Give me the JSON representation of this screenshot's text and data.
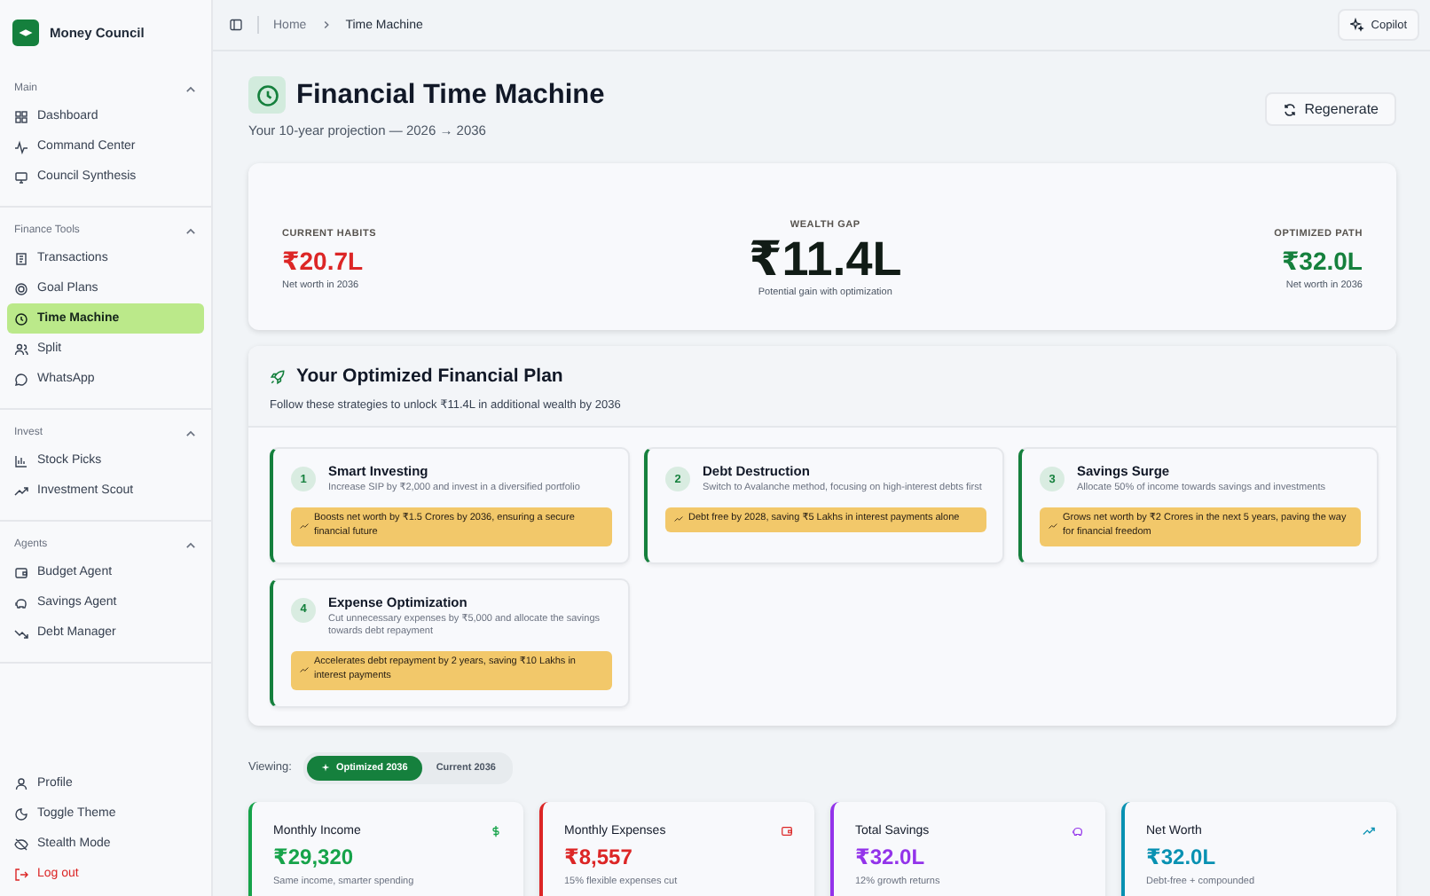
{
  "app": {
    "name": "Money Council"
  },
  "sidebar": {
    "sections": [
      {
        "title": "Main",
        "expanded": true,
        "items": [
          {
            "label": "Dashboard",
            "selected": false
          },
          {
            "label": "Command Center",
            "selected": false
          },
          {
            "label": "Council Synthesis",
            "selected": false
          }
        ]
      },
      {
        "title": "Finance Tools",
        "expanded": true,
        "items": [
          {
            "label": "Transactions",
            "selected": false
          },
          {
            "label": "Goal Plans",
            "selected": false
          },
          {
            "label": "Time Machine",
            "selected": true
          },
          {
            "label": "Split",
            "selected": false
          },
          {
            "label": "WhatsApp",
            "selected": false
          }
        ]
      },
      {
        "title": "Invest",
        "expanded": true,
        "items": [
          {
            "label": "Stock Picks",
            "selected": false
          },
          {
            "label": "Investment Scout",
            "selected": false
          }
        ]
      },
      {
        "title": "Agents",
        "expanded": true,
        "items": [
          {
            "label": "Budget Agent",
            "selected": false
          },
          {
            "label": "Savings Agent",
            "selected": false
          },
          {
            "label": "Debt Manager",
            "selected": false
          }
        ]
      }
    ],
    "footer": [
      {
        "label": "Profile",
        "kind": "normal"
      },
      {
        "label": "Toggle Theme",
        "kind": "normal"
      },
      {
        "label": "Stealth Mode",
        "kind": "normal"
      },
      {
        "label": "Log out",
        "kind": "danger"
      }
    ]
  },
  "breadcrumb": [
    "Home",
    "Time Machine"
  ],
  "copilot_button": "Copilot",
  "header": {
    "title": "Financial Time Machine",
    "subtitle": "Your 10-year projection — 2026 → 2036",
    "regenerate_button": "Regenerate"
  },
  "summary": {
    "current": {
      "label": "CURRENT HABITS",
      "value": "₹20.7L",
      "note": "Net worth in 2036"
    },
    "gap": {
      "label": "WEALTH GAP",
      "value": "₹11.4L",
      "note": "Potential gain with optimization"
    },
    "optimized": {
      "label": "OPTIMIZED PATH",
      "value": "₹32.0L",
      "note": "Net worth in 2036"
    }
  },
  "plan": {
    "title": "Your Optimized Financial Plan",
    "subtitle": "Follow these strategies to unlock ₹11.4L in additional wealth by 2036",
    "steps": [
      {
        "number": "1",
        "title": "Smart Investing",
        "description": "Increase SIP by ₹2,000 and invest in a diversified portfolio",
        "impact": "Boosts net worth by ₹1.5 Crores by 2036, ensuring a secure financial future"
      },
      {
        "number": "2",
        "title": "Debt Destruction",
        "description": "Switch to Avalanche method, focusing on high-interest debts first",
        "impact": "Debt free by 2028, saving ₹5 Lakhs in interest payments alone"
      },
      {
        "number": "3",
        "title": "Savings Surge",
        "description": "Allocate 50% of income towards savings and investments",
        "impact": "Grows net worth by ₹2 Crores in the next 5 years, paving the way for financial freedom"
      },
      {
        "number": "4",
        "title": "Expense Optimization",
        "description": "Cut unnecessary expenses by ₹5,000 and allocate the savings towards debt repayment",
        "impact": "Accelerates debt repayment by 2 years, saving ₹10 Lakhs in interest payments"
      }
    ]
  },
  "viewing": {
    "label": "Viewing:",
    "options": [
      {
        "label": "Optimized 2036",
        "selected": true
      },
      {
        "label": "Current 2036",
        "selected": false
      }
    ]
  },
  "stats": [
    {
      "title": "Monthly Income",
      "value": "₹29,320",
      "note": "Same income, smarter spending",
      "color": "#16a34a"
    },
    {
      "title": "Monthly Expenses",
      "value": "₹8,557",
      "note": "15% flexible expenses cut",
      "color": "#dc2626"
    },
    {
      "title": "Total Savings",
      "value": "₹32.0L",
      "note": "12% growth returns",
      "color": "#9333ea"
    },
    {
      "title": "Net Worth",
      "value": "₹32.0L",
      "note": "Debt-free + compounded",
      "color": "#0891b2"
    }
  ]
}
